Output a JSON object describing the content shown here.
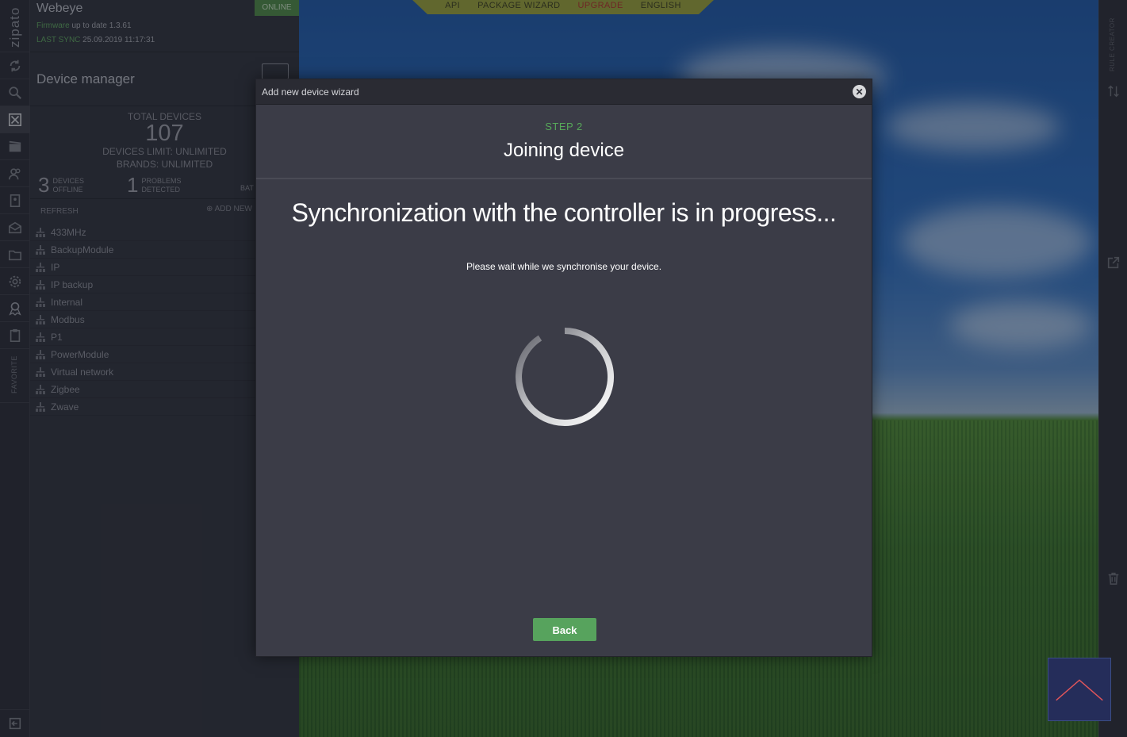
{
  "app": {
    "brand": "zipato",
    "controller_name": "Webeye",
    "firmware_label": "Firmware",
    "firmware_status": "up to date 1.3.61",
    "last_sync_label": "LAST SYNC",
    "last_sync_value": "25.09.2019 11:17:31",
    "online_badge": "ONLINE"
  },
  "top_nav": {
    "items": [
      {
        "label": "API"
      },
      {
        "label": "PACKAGE WIZARD"
      },
      {
        "label": "UPGRADE"
      },
      {
        "label": "ENGLISH"
      }
    ]
  },
  "rail": {
    "favorite_label": "FAVORITE",
    "icons": [
      "sync-icon",
      "search-icon",
      "device-manager-icon",
      "scenes-icon",
      "users-icon",
      "contacts-icon",
      "messages-icon",
      "files-icon",
      "settings-icon",
      "rules-icon",
      "clipboard-icon"
    ]
  },
  "right_rail": {
    "rule_creator_label": "RULE CREATOR",
    "icons": [
      "sort-icon",
      "external-link-icon",
      "trash-icon"
    ]
  },
  "device_manager": {
    "title": "Device manager",
    "total_label": "TOTAL DEVICES",
    "total_value": "107",
    "limit": "DEVICES LIMIT: UNLIMITED",
    "brands": "BRANDS: UNLIMITED",
    "offline_count": "3",
    "offline_label_1": "DEVICES",
    "offline_label_2": "OFFLINE",
    "problems_count": "1",
    "problems_label_1": "PROBLEMS",
    "problems_label_2": "DETECTED",
    "battery_label": "BAT",
    "refresh": "REFRESH",
    "add_new": "ADD NEW",
    "networks": [
      {
        "label": "433MHz"
      },
      {
        "label": "BackupModule"
      },
      {
        "label": "IP"
      },
      {
        "label": "IP backup"
      },
      {
        "label": "Internal"
      },
      {
        "label": "Modbus"
      },
      {
        "label": "P1"
      },
      {
        "label": "PowerModule"
      },
      {
        "label": "Virtual network"
      },
      {
        "label": "Zigbee"
      },
      {
        "label": "Zwave"
      }
    ]
  },
  "wizard": {
    "title": "Add new device wizard",
    "step": "STEP 2",
    "step_title": "Joining device",
    "heading": "Synchronization with the controller is in progress...",
    "message": "Please wait while we synchronise your device.",
    "back_label": "Back"
  },
  "colors": {
    "accent_green": "#57a35d",
    "upgrade_red": "#b0352a",
    "modal_bg": "#3b3c47"
  }
}
